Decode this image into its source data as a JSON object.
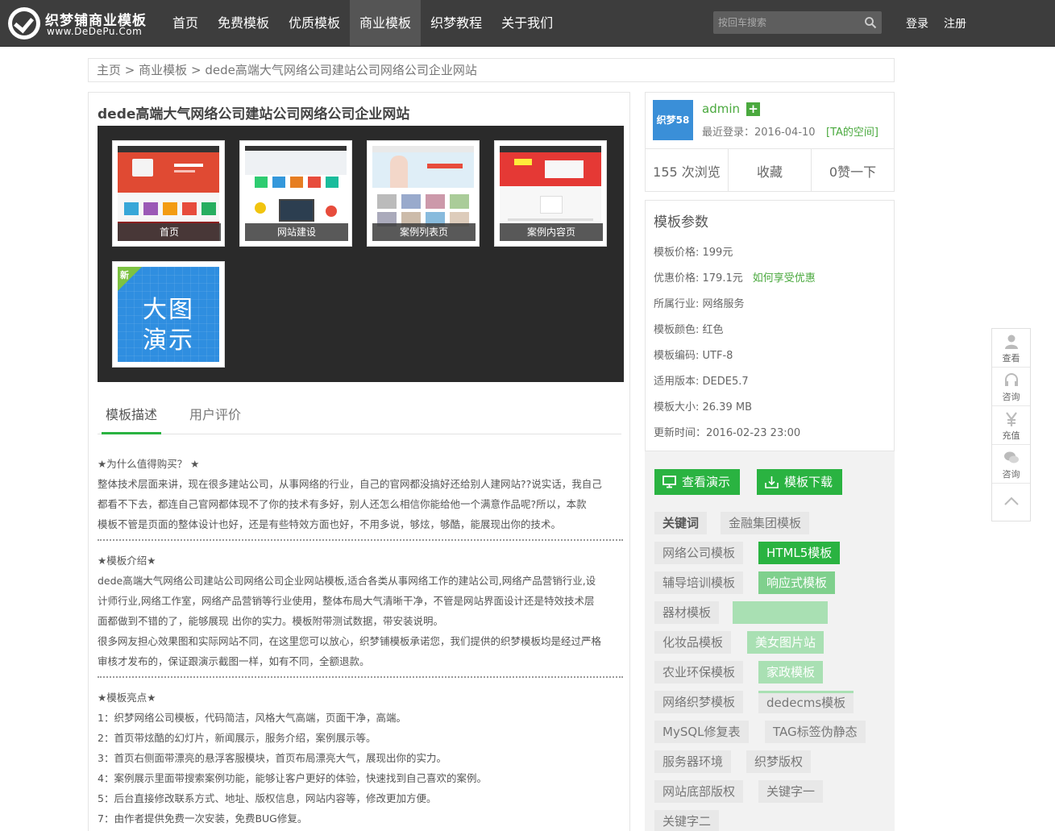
{
  "header": {
    "logo_cn": "织梦铺商业模板",
    "logo_en": "www.DeDePu.Com",
    "nav": [
      "首页",
      "免费模板",
      "优质模板",
      "商业模板",
      "织梦教程",
      "关于我们"
    ],
    "search_placeholder": "按回车搜索",
    "login": "登录",
    "register": "注册"
  },
  "breadcrumb": {
    "home": "主页",
    "sep": ">",
    "category": "商业模板",
    "current": "dede高端大气网络公司建站公司网络公司企业网站"
  },
  "template": {
    "title": "dede高端大气网络公司建站公司网络公司企业网站",
    "thumbs": [
      {
        "caption": "首页"
      },
      {
        "caption": "网站建设"
      },
      {
        "caption": "案例列表页"
      },
      {
        "caption": "案例内容页"
      }
    ],
    "bigdemo": {
      "badge": "新",
      "line1": "大图",
      "line2": "演示"
    }
  },
  "tabs": [
    "模板描述",
    "用户评价"
  ],
  "description": {
    "why_title": "★为什么值得购买？ ★",
    "why_lines": [
      "整体技术层面来讲，现在很多建站公司，从事网络的行业，自己的官网都没搞好还给别人建网站??说实话，我自己",
      "都看不下去，都连自己官网都体现不了你的技术有多好，别人还怎么相信你能给他一个满意作品呢?所以，本款",
      "模板不管是页面的整体设计也好，还是有些特效方面也好，不用多说，够炫，够酷，能展现出你的技术。"
    ],
    "intro_title": "★模板介绍★",
    "intro_lines": [
      "dede高端大气网络公司建站公司网络公司企业网站模板,适合各类从事网络工作的建站公司,网络产品营销行业,设",
      "计师行业,网络工作室，网络产品营销等行业使用，整体布局大气清晰干净，不管是网站界面设计还是特效技术层",
      "面都做到不错的了，能够展现 出你的实力。模板附带测试数据，带安装说明。",
      "很多网友担心效果图和实际网站不同，在这里您可以放心，织梦铺模板承诺您，我们提供的织梦模板均是经过严格",
      "审核才发布的，保证跟演示截图一样，如有不同，全额退款。"
    ],
    "features_title": "★模板亮点★",
    "features_lines": [
      "1：织梦网络公司模板，代码简洁，风格大气高端，页面干净，高端。",
      "2：首页带炫酷的幻灯片，新闻展示，服务介绍，案例展示等。",
      "3：首页右侧面带漂亮的悬浮客服模块，首页布局漂亮大气，展现出你的实力。",
      "4：案例展示里面带搜索案例功能，能够让客户更好的体验，快速找到自己喜欢的案例。",
      "5：后台直接修改联系方式、地址、版权信息，网站内容等，修改更加方便。",
      "7：由作者提供免费一次安装，免费BUG修复。"
    ]
  },
  "author": {
    "avatar_text": "织梦58",
    "name": "admin",
    "last_login": "最近登录：2016-04-10",
    "space_link": "[TA的空间]",
    "views": "155 次浏览",
    "favorite": "收藏",
    "like": "0赞一下"
  },
  "params": {
    "title": "模板参数",
    "items": [
      "模板价格: 199元",
      "优惠价格: 179.1元",
      "所属行业: 网络服务",
      "模板颜色: 红色",
      "模板编码: UTF-8",
      "适用版本: DEDE5.7",
      "模板大小: 26.39 MB",
      "更新时间：2016-02-23 23:00"
    ],
    "discount_link": "如何享受优惠"
  },
  "actions": {
    "demo": "查看演示",
    "download": "模板下载"
  },
  "tags": [
    "关键词",
    "金融集团模板",
    "网络公司模板",
    "HTML5模板",
    "辅导培训模板",
    "响应式模板",
    "器材模板",
    "",
    "化妆品模板",
    "美女图片站",
    "农业环保模板",
    "家政模板",
    "网络织梦模板",
    "dedecms模板",
    "MySQL修复表",
    "TAG标签伪静态",
    "服务器环境",
    "织梦版权",
    "网站底部版权",
    "关键字一",
    "关键字二"
  ],
  "side": [
    "查看",
    "咨询",
    "充值",
    "咨询"
  ],
  "colors": {
    "header_bg": "#3d3d3d",
    "accent_green": "#2ab341",
    "link_green": "#4aa93e",
    "avatar_blue": "#3a8fd8"
  }
}
